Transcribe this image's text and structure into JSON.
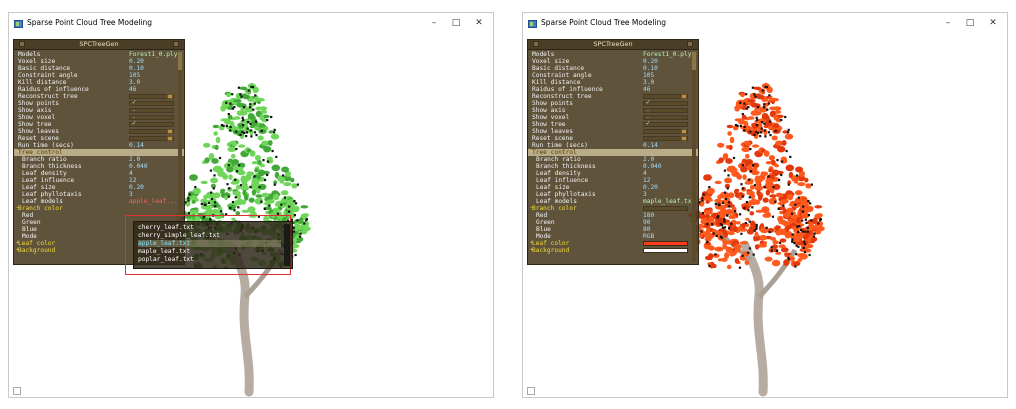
{
  "colors": {
    "panel_bg": "#4e4026",
    "value": "#9fdcff",
    "group_label": "#f2da39",
    "leaves_green": "#6fd65a",
    "leaves_orange": "#ff5a1e",
    "trunk": "#b6aca2",
    "red_highlight": "#e03030"
  },
  "windows": [
    {
      "side": "left",
      "title": "Sparse Point Cloud Tree Modeling",
      "buttons": {
        "minimize": "–",
        "maximize": "□",
        "close": "✕"
      },
      "panel": {
        "title": "SPCTreeGen",
        "rows": {
          "models": {
            "label": "Models",
            "value": "Forest1_0.ply"
          },
          "voxel": {
            "label": "Voxel size",
            "value": "0.20"
          },
          "basic": {
            "label": "Basic distance",
            "value": "0.10"
          },
          "constraint": {
            "label": "Constraint angle",
            "value": "105"
          },
          "kill": {
            "label": "Kill distance",
            "value": "3.0"
          },
          "radius": {
            "label": "Raidus of influence",
            "value": "46"
          },
          "reconstruct": {
            "label": "Reconstruct tree"
          },
          "show_points": {
            "label": "Show points",
            "value": "✓"
          },
          "show_axis": {
            "label": "Show axis",
            "value": "-"
          },
          "show_voxel": {
            "label": "Show voxel",
            "value": "-"
          },
          "show_tree": {
            "label": "Show tree",
            "value": "✓"
          },
          "show_leaves": {
            "label": "Show leaves"
          },
          "reset": {
            "label": "Reset scene"
          },
          "run_time": {
            "label": "Run time (secs)",
            "value": "0.14"
          },
          "tree_control": {
            "label": "Tree control"
          },
          "branch_ratio": {
            "label": "Branch ratio",
            "value": "2.0"
          },
          "branch_thickness": {
            "label": "Branch thickness",
            "value": "0.040"
          },
          "leaf_density": {
            "label": "Leaf density",
            "value": "4"
          },
          "leaf_influence": {
            "label": "Leaf influence",
            "value": "12"
          },
          "leaf_size": {
            "label": "Leaf size",
            "value": "0.20"
          },
          "leaf_phyllotaxis": {
            "label": "Leaf phyllotaxis",
            "value": "3"
          },
          "leaf_models": {
            "label": "Leaf models",
            "value": "apple_leaf..."
          },
          "branch_color": {
            "label": "Branch color"
          },
          "red": {
            "label": "Red",
            "value": ""
          },
          "green": {
            "label": "Green",
            "value": ""
          },
          "blue": {
            "label": "Blue",
            "value": ""
          },
          "mode": {
            "label": "Mode",
            "value": ""
          },
          "leaf_color": {
            "label": "Leaf color"
          },
          "background": {
            "label": "Background"
          }
        },
        "dropdown": {
          "options": [
            "cherry_leaf.txt",
            "cherry_simple_leaf.txt",
            "apple_leaf.txt",
            "maple_leaf.txt",
            "poplar_leaf.txt"
          ],
          "highlighted": "apple_leaf.txt"
        }
      }
    },
    {
      "side": "right",
      "title": "Sparse Point Cloud Tree Modeling",
      "buttons": {
        "minimize": "–",
        "maximize": "□",
        "close": "✕"
      },
      "panel": {
        "title": "SPCTreeGen",
        "rows": {
          "models": {
            "label": "Models",
            "value": "Forest1_0.ply"
          },
          "voxel": {
            "label": "Voxel size",
            "value": "0.20"
          },
          "basic": {
            "label": "Basic distance",
            "value": "0.10"
          },
          "constraint": {
            "label": "Constraint angle",
            "value": "105"
          },
          "kill": {
            "label": "Kill distance",
            "value": "3.0"
          },
          "radius": {
            "label": "Raidus of influence",
            "value": "46"
          },
          "reconstruct": {
            "label": "Reconstruct tree"
          },
          "show_points": {
            "label": "Show points",
            "value": "✓"
          },
          "show_axis": {
            "label": "Show axis",
            "value": "-"
          },
          "show_voxel": {
            "label": "Show voxel",
            "value": "-"
          },
          "show_tree": {
            "label": "Show tree",
            "value": "✓"
          },
          "show_leaves": {
            "label": "Show leaves"
          },
          "reset": {
            "label": "Reset scene"
          },
          "run_time": {
            "label": "Run time (secs)",
            "value": "0.14"
          },
          "tree_control": {
            "label": "Tree control"
          },
          "branch_ratio": {
            "label": "Branch ratio",
            "value": "2.0"
          },
          "branch_thickness": {
            "label": "Branch thickness",
            "value": "0.040"
          },
          "leaf_density": {
            "label": "Leaf density",
            "value": "4"
          },
          "leaf_influence": {
            "label": "Leaf influence",
            "value": "12"
          },
          "leaf_size": {
            "label": "Leaf size",
            "value": "0.20"
          },
          "leaf_phyllotaxis": {
            "label": "Leaf phyllotaxis",
            "value": "3"
          },
          "leaf_models": {
            "label": "Leaf models",
            "value": "maple_leaf.txt"
          },
          "branch_color": {
            "label": "Branch color"
          },
          "red": {
            "label": "Red",
            "value": "180"
          },
          "green": {
            "label": "Green",
            "value": "90"
          },
          "blue": {
            "label": "Blue",
            "value": "80"
          },
          "mode": {
            "label": "Mode",
            "value": "RGB"
          },
          "leaf_color": {
            "label": "Leaf color",
            "swatch": "#ff3a1a"
          },
          "background": {
            "label": "Background",
            "swatch": "#ffffff"
          }
        }
      }
    }
  ]
}
